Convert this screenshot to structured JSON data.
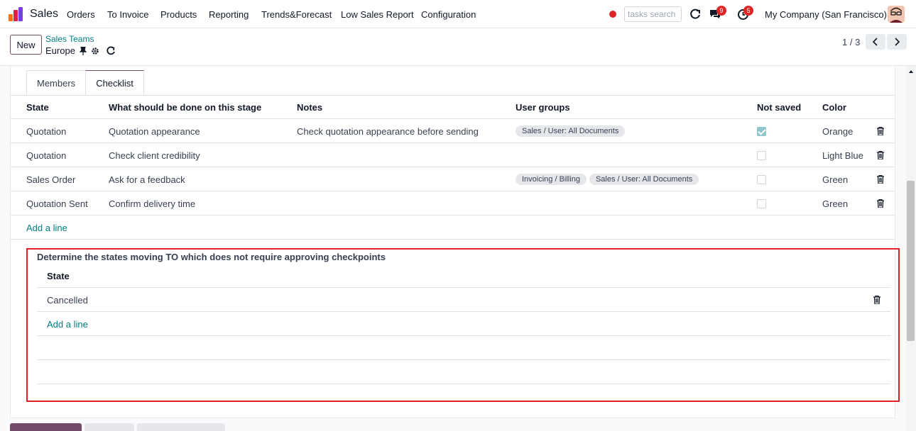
{
  "topnav": {
    "app_name": "Sales",
    "menu": [
      "Orders",
      "To Invoice",
      "Products",
      "Reporting",
      "Trends&Forecast",
      "Low Sales Report",
      "Configuration"
    ],
    "search_placeholder": "tasks search",
    "messages_badge": "9",
    "activities_badge": "5",
    "company": "My Company (San Francisco)"
  },
  "control_panel": {
    "new_label": "New",
    "breadcrumb_parent": "Sales Teams",
    "breadcrumb_current": "Europe",
    "pager": "1 / 3"
  },
  "tabs": [
    "Members",
    "Checklist"
  ],
  "checklist": {
    "headers": [
      "State",
      "What should be done on this stage",
      "Notes",
      "User groups",
      "Not saved",
      "Color"
    ],
    "rows": [
      {
        "state": "Quotation",
        "task": "Quotation appearance",
        "notes": "Check quotation appearance before sending",
        "groups": [
          "Sales / User: All Documents"
        ],
        "checked": true,
        "color": "Orange"
      },
      {
        "state": "Quotation",
        "task": "Check client credibility",
        "notes": "",
        "groups": [],
        "checked": false,
        "color": "Light Blue"
      },
      {
        "state": "Sales Order",
        "task": "Ask for a feedback",
        "notes": "",
        "groups": [
          "Invoicing / Billing",
          "Sales / User: All Documents"
        ],
        "checked": false,
        "color": "Green"
      },
      {
        "state": "Quotation Sent",
        "task": "Confirm delivery time",
        "notes": "",
        "groups": [],
        "checked": false,
        "color": "Green"
      }
    ],
    "add_line": "Add a line"
  },
  "states_section": {
    "title": "Determine the states moving TO which does not require approving checkpoints",
    "header": "State",
    "rows": [
      "Cancelled"
    ],
    "add_line": "Add a line"
  },
  "colors": {
    "brand": "#714b67",
    "link": "#017e84",
    "highlight_border": "#e11d2b",
    "badge": "#dc2626"
  }
}
